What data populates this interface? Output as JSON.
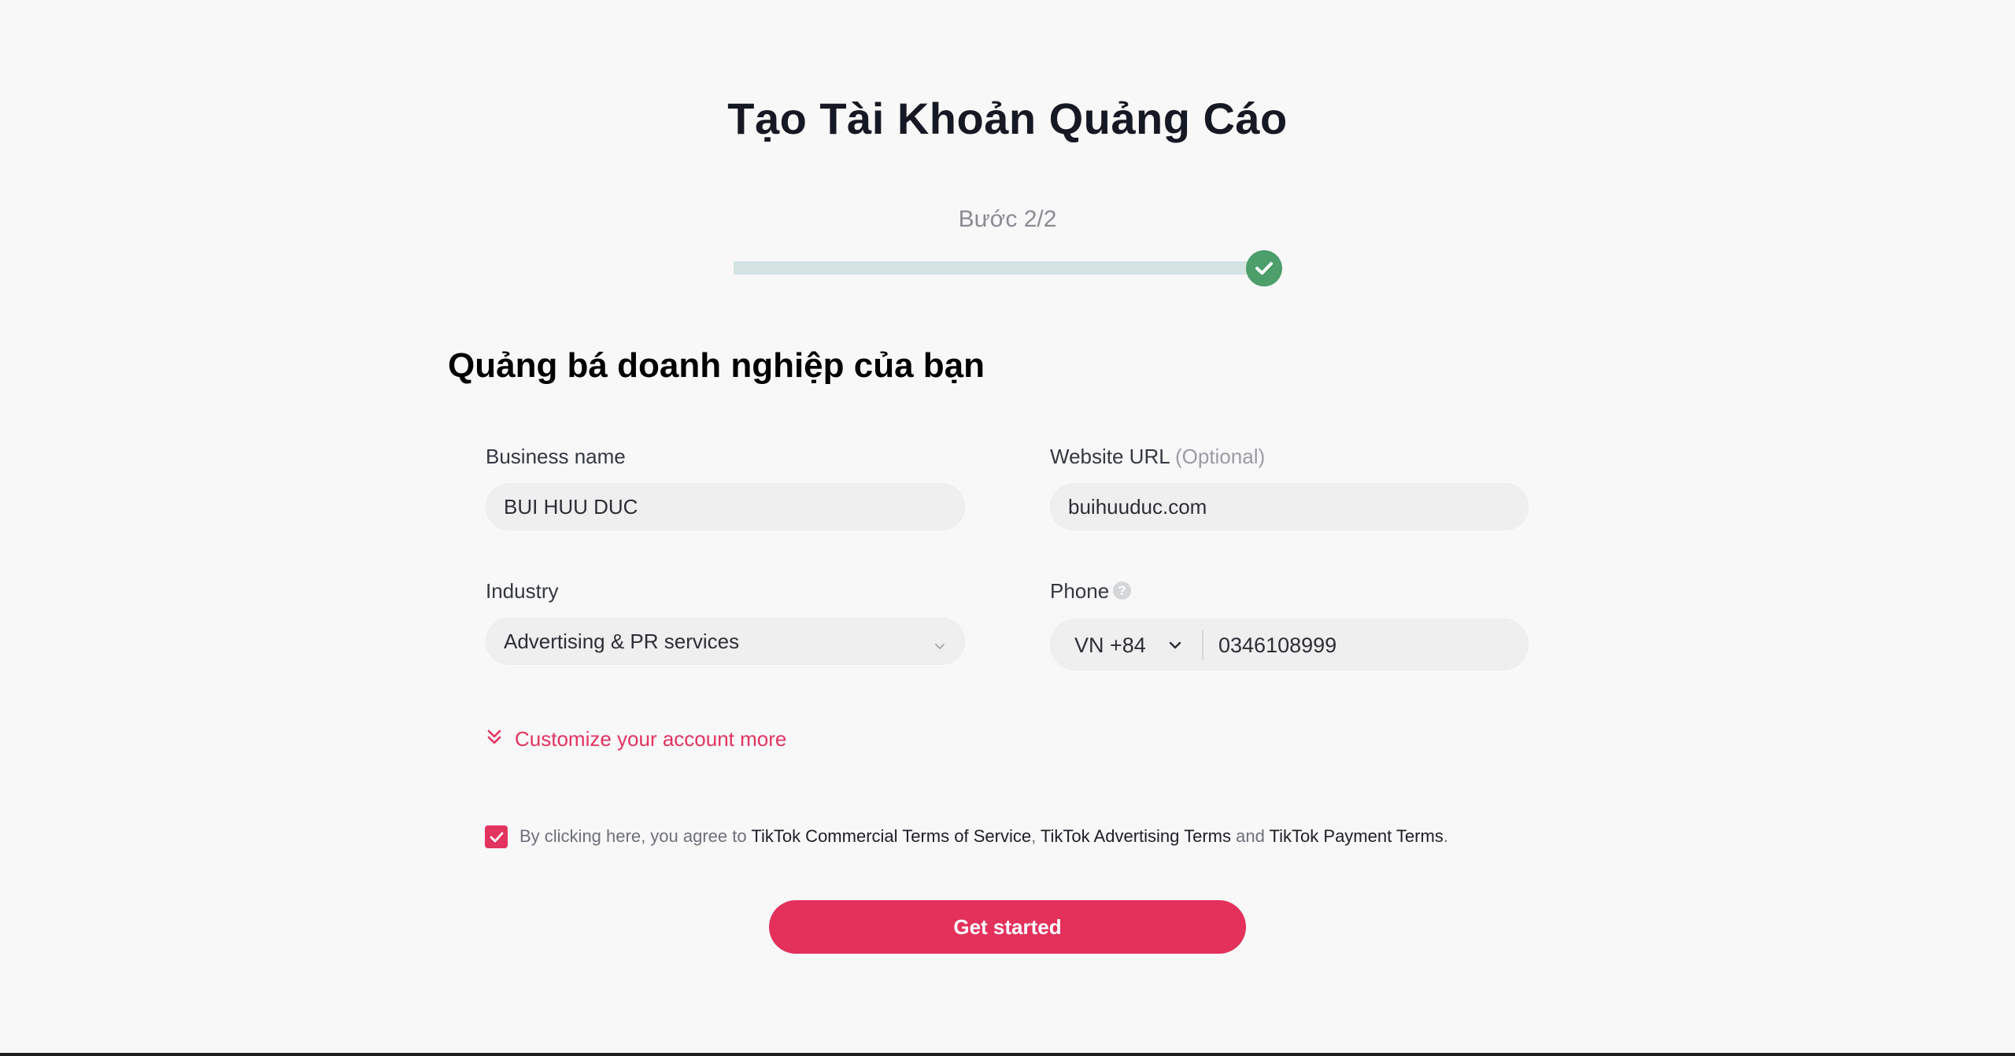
{
  "header": {
    "title": "Tạo Tài Khoản Quảng Cáo",
    "step_label": "Bước 2/2",
    "progress_fraction": 1.0,
    "progress_icon": "check-icon"
  },
  "section": {
    "title": "Quảng bá doanh nghiệp của bạn"
  },
  "form": {
    "business_name": {
      "label": "Business name",
      "value": "BUI HUU DUC"
    },
    "website": {
      "label": "Website URL",
      "optional_label": "(Optional)",
      "value": "buihuuduc.com"
    },
    "industry": {
      "label": "Industry",
      "value": "Advertising & PR services"
    },
    "phone": {
      "label": "Phone",
      "help_icon": "?",
      "country_code": "VN +84",
      "number": "0346108999"
    },
    "customize_link": "Customize your account more",
    "terms": {
      "checked": true,
      "prefix": "By clicking here, you agree to ",
      "link1": "TikTok Commercial Terms of Service",
      "sep1": ", ",
      "link2": "TikTok Advertising Terms",
      "sep2": " and ",
      "link3": "TikTok Payment Terms",
      "suffix": "."
    },
    "submit_label": "Get started"
  },
  "colors": {
    "accent": "#e3335f",
    "success": "#4c9e6a",
    "progress_track": "#d6e3e3",
    "background": "#f8f8f9"
  }
}
